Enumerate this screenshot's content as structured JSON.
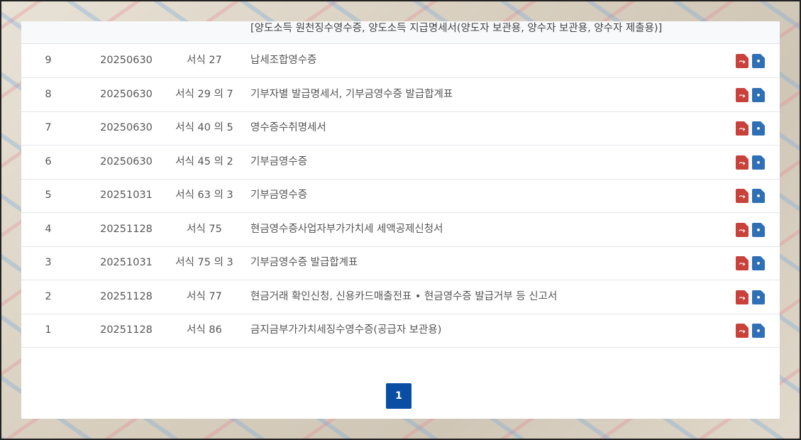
{
  "top_partial_row": {
    "name": "[양도소득 원천징수영수증, 양도소득 지급명세서(양도자 보관용, 양수자 보관용, 양수자 제출용)]"
  },
  "rows": [
    {
      "no": "9",
      "date": "20250630",
      "form": "서식 27",
      "name": "납세조합영수증"
    },
    {
      "no": "8",
      "date": "20250630",
      "form": "서식 29 의 7",
      "name": "기부자별 발급명세서, 기부금영수증 발급합계표"
    },
    {
      "no": "7",
      "date": "20250630",
      "form": "서식 40 의 5",
      "name": "영수증수취명세서"
    },
    {
      "no": "6",
      "date": "20250630",
      "form": "서식 45 의 2",
      "name": "기부금영수증"
    },
    {
      "no": "5",
      "date": "20251031",
      "form": "서식 63 의 3",
      "name": "기부금영수증"
    },
    {
      "no": "4",
      "date": "20251128",
      "form": "서식 75",
      "name": "현금영수증사업자부가가치세 세액공제신청서"
    },
    {
      "no": "3",
      "date": "20251031",
      "form": "서식 75 의 3",
      "name": "기부금영수증 발급합계표"
    },
    {
      "no": "2",
      "date": "20251128",
      "form": "서식 77",
      "name": "현금거래 확인신청, 신용카드매출전표 • 현금영수증 발급거부 등 신고서"
    },
    {
      "no": "1",
      "date": "20251128",
      "form": "서식 86",
      "name": "금지금부가가치세징수영수증(공급자 보관용)"
    }
  ],
  "icons": {
    "pdf": "pdf-download-icon",
    "hwp": "hwp-download-icon"
  },
  "colors": {
    "pdf_icon": "#c8413a",
    "hwp_icon": "#2e6fb5",
    "pager_active": "#0a4ea3"
  },
  "pagination": {
    "current": "1"
  }
}
